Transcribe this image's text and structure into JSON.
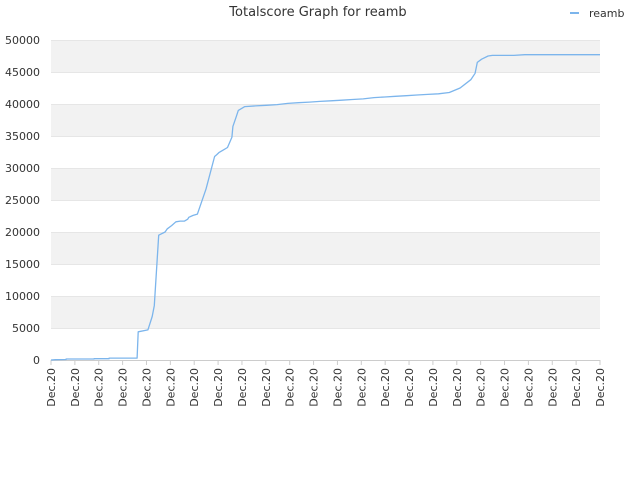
{
  "chart_data": {
    "type": "line",
    "title": "Totalscore Graph for reamb",
    "xlabel": "",
    "ylabel": "",
    "ylim": [
      0,
      50000
    ],
    "yticks": [
      0,
      5000,
      10000,
      15000,
      20000,
      25000,
      30000,
      35000,
      40000,
      45000,
      50000
    ],
    "xtick_labels": [
      "Dec.20",
      "Dec.20",
      "Dec.20",
      "Dec.20",
      "Dec.20",
      "Dec.20",
      "Dec.20",
      "Dec.20",
      "Dec.20",
      "Dec.20",
      "Dec.20",
      "Dec.20",
      "Dec.20",
      "Dec.20",
      "Dec.20",
      "Dec.20",
      "Dec.20",
      "Dec.20",
      "Dec.20",
      "Dec.20",
      "Dec.20",
      "Dec.20",
      "Dec.20",
      "Dec.20"
    ],
    "legend": {
      "position": "top-right"
    },
    "grid": "horizontal alternating bands",
    "colors": {
      "series": "#7cb5ec",
      "band": "#f2f2f2",
      "grid": "#e6e6e6",
      "axis": "#cccccc"
    },
    "series": [
      {
        "name": "reamb",
        "x": [
          0,
          0.02,
          0.07,
          0.07,
          0.2,
          0.2,
          0.27,
          0.27,
          0.4,
          0.405,
          0.45,
          0.47,
          0.48,
          0.49,
          0.5,
          0.53,
          0.54,
          0.56,
          0.58,
          0.6,
          0.62,
          0.635,
          0.64,
          0.66,
          0.68,
          0.72,
          0.76,
          0.77,
          0.78,
          0.8,
          0.82,
          0.84,
          0.845,
          0.86,
          0.87,
          0.9,
          0.95,
          1.0,
          1.05,
          1.1,
          1.15,
          1.2,
          1.25,
          1.3,
          1.35,
          1.4,
          1.45,
          1.5,
          1.55,
          1.6,
          1.65,
          1.7,
          1.75,
          1.8,
          1.85,
          1.9,
          1.95,
          1.97,
          1.98,
          2.0,
          2.03,
          2.05,
          2.09,
          2.15,
          2.2,
          2.3,
          2.4,
          2.5,
          2.55
        ],
        "values": [
          0,
          50,
          80,
          150,
          150,
          200,
          200,
          300,
          300,
          4400,
          4700,
          6800,
          8500,
          14000,
          19500,
          20000,
          20500,
          21000,
          21600,
          21700,
          21700,
          22000,
          22300,
          22600,
          22800,
          26700,
          31800,
          32100,
          32400,
          32800,
          33200,
          34800,
          36500,
          38000,
          39000,
          39600,
          39700,
          39800,
          39900,
          40100,
          40200,
          40300,
          40400,
          40500,
          40600,
          40700,
          40800,
          41000,
          41100,
          41200,
          41300,
          41400,
          41500,
          41600,
          41800,
          42500,
          43800,
          44800,
          46500,
          47000,
          47500,
          47600,
          47600,
          47600,
          47700,
          47700,
          47700,
          47700,
          47700
        ]
      }
    ]
  }
}
